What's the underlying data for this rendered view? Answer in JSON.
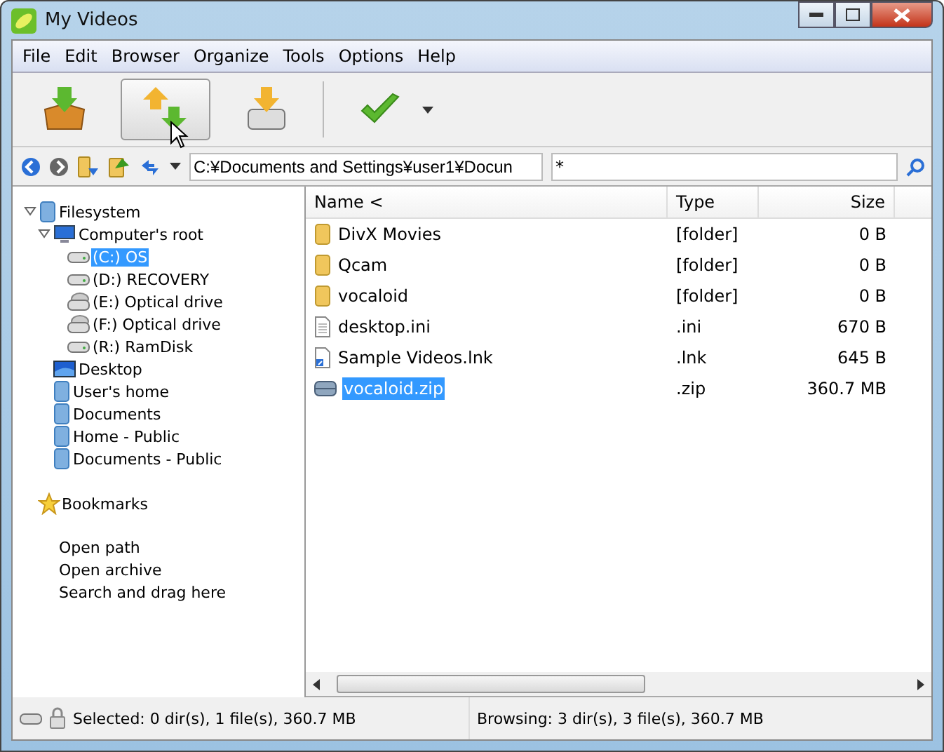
{
  "window": {
    "title": "My Videos"
  },
  "menu": [
    "File",
    "Edit",
    "Browser",
    "Organize",
    "Tools",
    "Options",
    "Help"
  ],
  "toolbar": [
    {
      "kind": "extract",
      "selected": false
    },
    {
      "kind": "move",
      "selected": true
    },
    {
      "kind": "drive",
      "selected": false
    },
    {
      "kind": "check",
      "selected": false
    }
  ],
  "address": {
    "path": "C:¥Documents and Settings¥user1¥Docun",
    "filter": "*"
  },
  "tree": [
    {
      "label": "Filesystem",
      "kind": "folder",
      "selected": false,
      "expanded": true,
      "children": [
        {
          "label": "Computer's root",
          "kind": "computer",
          "selected": false,
          "expanded": true,
          "children": [
            {
              "label": "(C:) OS",
              "kind": "drive",
              "selected": true
            },
            {
              "label": "(D:) RECOVERY",
              "kind": "drive",
              "selected": false
            },
            {
              "label": "(E:) Optical drive",
              "kind": "optical",
              "selected": false
            },
            {
              "label": "(F:) Optical drive",
              "kind": "optical",
              "selected": false
            },
            {
              "label": "(R:) RamDisk",
              "kind": "drive",
              "selected": false
            }
          ]
        },
        {
          "label": "Desktop",
          "kind": "desktop",
          "selected": false
        },
        {
          "label": "User's home",
          "kind": "folder",
          "selected": false
        },
        {
          "label": "Documents",
          "kind": "folder",
          "selected": false
        },
        {
          "label": "Home - Public",
          "kind": "folder",
          "selected": false
        },
        {
          "label": "Documents - Public",
          "kind": "folder",
          "selected": false
        }
      ]
    }
  ],
  "bookmarks": {
    "label": "Bookmarks",
    "items": [
      "Open path",
      "Open archive",
      "Search and drag here"
    ]
  },
  "table": {
    "columns": [
      "Name <",
      "Type",
      "Size"
    ],
    "rows": [
      {
        "name": "DivX Movies",
        "type": "[folder]",
        "size": "0 B",
        "kind": "folder",
        "selected": false
      },
      {
        "name": "Qcam",
        "type": "[folder]",
        "size": "0 B",
        "kind": "folder",
        "selected": false
      },
      {
        "name": "vocaloid",
        "type": "[folder]",
        "size": "0 B",
        "kind": "folder",
        "selected": false
      },
      {
        "name": "desktop.ini",
        "type": ".ini",
        "size": "670 B",
        "kind": "file",
        "selected": false
      },
      {
        "name": "Sample Videos.lnk",
        "type": ".lnk",
        "size": "645 B",
        "kind": "link",
        "selected": false
      },
      {
        "name": "vocaloid.zip",
        "type": ".zip",
        "size": "360.7 MB",
        "kind": "archive",
        "selected": true
      }
    ]
  },
  "status_bar": {
    "selected": "Selected: 0 dir(s), 1 file(s), 360.7 MB",
    "browsing": "Browsing: 3 dir(s), 3 file(s), 360.7 MB"
  }
}
